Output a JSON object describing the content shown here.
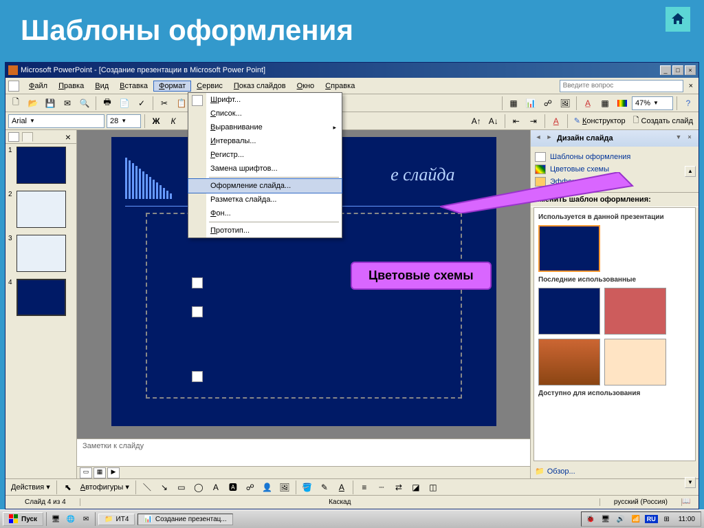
{
  "slide_header": "Шаблоны оформления",
  "titlebar": "Microsoft PowerPoint - [Создание презентации в Microsoft Power Point]",
  "menubar": {
    "items": [
      "Файл",
      "Правка",
      "Вид",
      "Вставка",
      "Формат",
      "Сервис",
      "Показ слайдов",
      "Окно",
      "Справка"
    ],
    "active": "Формат",
    "question_placeholder": "Введите вопрос"
  },
  "format_toolbar": {
    "font_name": "Arial",
    "font_size": "28",
    "zoom": "47%",
    "designer_label": "Конструктор",
    "new_slide_label": "Создать слайд"
  },
  "dropdown": {
    "items": [
      {
        "label": "Шрифт...",
        "icon": true
      },
      {
        "label": "Список..."
      },
      {
        "label": "Выравнивание",
        "submenu": true
      },
      {
        "label": "Интервалы..."
      },
      {
        "label": "Регистр..."
      },
      {
        "label": "Замена шрифтов..."
      },
      {
        "sep": true
      },
      {
        "label": "Оформление слайда...",
        "icon": true,
        "highlighted": true
      },
      {
        "label": "Разметка слайда...",
        "icon": true
      },
      {
        "label": "Фон..."
      },
      {
        "sep": true
      },
      {
        "label": "Прототип...",
        "icon": true
      }
    ]
  },
  "callout": "Цветовые схемы",
  "slide_panel": {
    "thumbs": [
      "1",
      "2",
      "3",
      "4"
    ],
    "selected": 4
  },
  "canvas": {
    "title_fragment": "е слайда",
    "notes_placeholder": "Заметки к слайду"
  },
  "task_pane": {
    "title": "Дизайн слайда",
    "links": [
      {
        "label": "Шаблоны оформления",
        "type": "templates"
      },
      {
        "label": "Цветовые схемы",
        "type": "colors"
      },
      {
        "label": "Эффекты анимации",
        "type": "effects"
      }
    ],
    "apply_label": "именить шаблон оформления:",
    "group_current": "Используется в данной презентации",
    "group_recent": "Последние использованные",
    "group_available": "Доступно для использования",
    "browse": "Обзор..."
  },
  "draw_toolbar": {
    "actions_label": "Действия",
    "autoshapes_label": "Автофигуры"
  },
  "statusbar": {
    "slide_info": "Слайд 4 из 4",
    "layout": "Каскад",
    "language": "русский (Россия)"
  },
  "taskbar": {
    "start": "Пуск",
    "folder": "ИТ4",
    "app": "Создание презентац...",
    "lang": "RU",
    "clock": "11:00"
  }
}
